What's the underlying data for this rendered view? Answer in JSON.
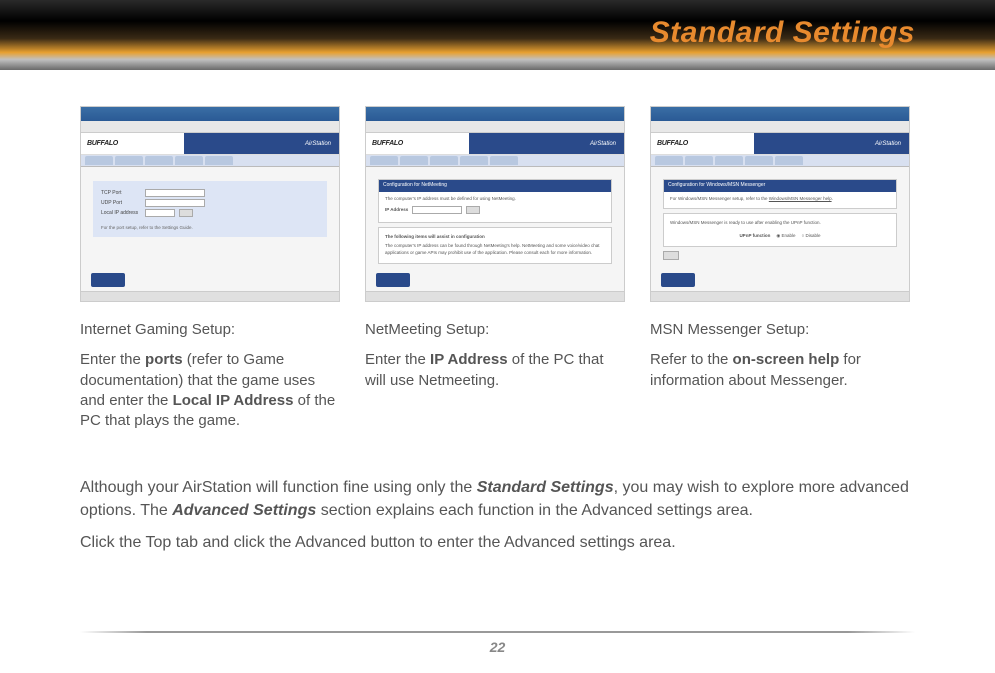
{
  "header": {
    "title": "Standard Settings"
  },
  "screenshots": {
    "logo": "BUFFALO",
    "brand": "AirStation"
  },
  "captions": [
    {
      "title": "Internet Gaming Setup:",
      "body_parts": [
        "Enter the ",
        "ports",
        " (refer to Game documentation) that the game uses and enter the ",
        "Local IP Address",
        " of the PC that plays the game."
      ]
    },
    {
      "title": "NetMeeting Setup:",
      "body_parts": [
        "Enter the ",
        "IP Address",
        " of the PC that will use Netmeeting."
      ]
    },
    {
      "title": "MSN Messenger Setup:",
      "body_parts": [
        "Refer to the ",
        "on-screen help",
        " for information about Messenger."
      ]
    }
  ],
  "bottom": {
    "p1_parts": [
      "Although your AirStation will function fine using only the ",
      "Standard Settings",
      ", you may wish to explore more advanced options.  The ",
      "Advanced Settings",
      " section explains each function in the Advanced settings area."
    ],
    "p2": "Click the Top tab and click the Advanced button to enter the Advanced settings area."
  },
  "pageNumber": "22"
}
